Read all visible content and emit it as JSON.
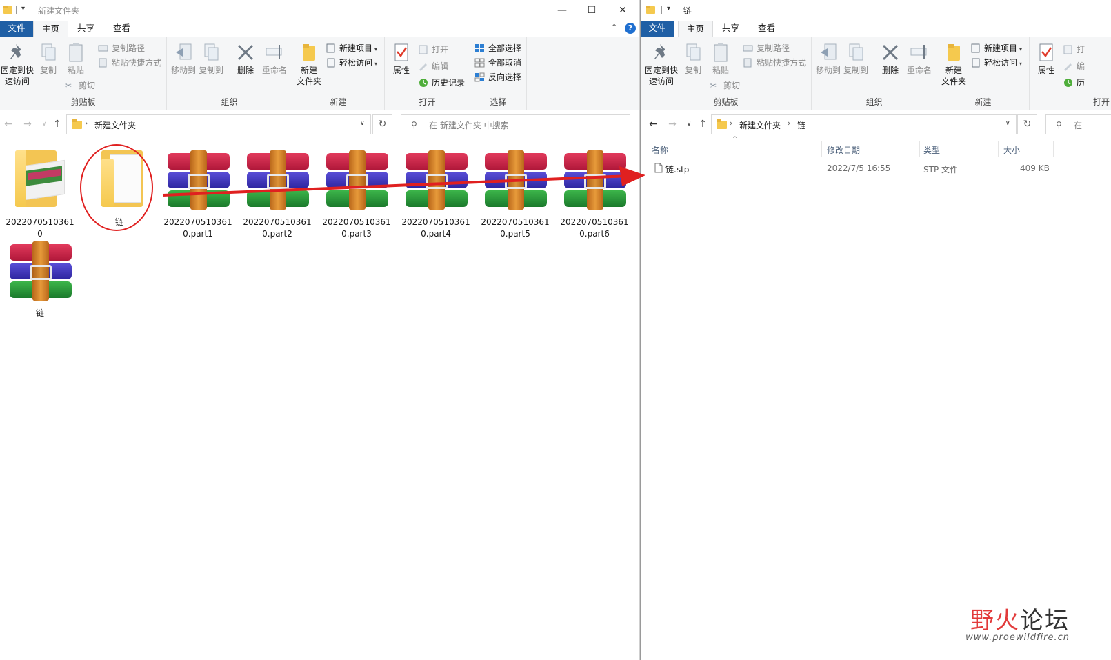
{
  "left": {
    "title": "新建文件夹",
    "tabs": {
      "file": "文件",
      "home": "主页",
      "share": "共享",
      "view": "查看"
    },
    "ribbon": {
      "pin": "固定到快\n速访问",
      "copy": "复制",
      "paste": "粘贴",
      "copy_path": "复制路径",
      "paste_shortcut": "粘贴快捷方式",
      "cut": "剪切",
      "clipboard": "剪贴板",
      "move_to": "移动到",
      "copy_to": "复制到",
      "delete": "删除",
      "rename": "重命名",
      "organize": "组织",
      "new_folder": "新建\n文件夹",
      "new_item": "新建项目",
      "easy_access": "轻松访问",
      "new": "新建",
      "properties": "属性",
      "open": "打开",
      "edit": "编辑",
      "history": "历史记录",
      "open_group": "打开",
      "select_all": "全部选择",
      "select_none": "全部取消",
      "invert": "反向选择",
      "select": "选择"
    },
    "address": {
      "crumb1": "新建文件夹"
    },
    "search_placeholder": "在 新建文件夹 中搜索",
    "items": [
      {
        "label": "2022070510361\n0",
        "kind": "folder-thumb"
      },
      {
        "label": "链",
        "kind": "folder"
      },
      {
        "label": "2022070510361\n0.part1",
        "kind": "rar"
      },
      {
        "label": "2022070510361\n0.part2",
        "kind": "rar"
      },
      {
        "label": "2022070510361\n0.part3",
        "kind": "rar"
      },
      {
        "label": "2022070510361\n0.part4",
        "kind": "rar"
      },
      {
        "label": "2022070510361\n0.part5",
        "kind": "rar"
      },
      {
        "label": "2022070510361\n0.part6",
        "kind": "rar"
      },
      {
        "label": "链",
        "kind": "rar"
      }
    ]
  },
  "right": {
    "title": "链",
    "tabs": {
      "file": "文件",
      "home": "主页",
      "share": "共享",
      "view": "查看"
    },
    "ribbon": {
      "pin": "固定到快\n速访问",
      "copy": "复制",
      "paste": "粘贴",
      "copy_path": "复制路径",
      "paste_shortcut": "粘贴快捷方式",
      "cut": "剪切",
      "clipboard": "剪贴板",
      "move_to": "移动到",
      "copy_to": "复制到",
      "delete": "删除",
      "rename": "重命名",
      "organize": "组织",
      "new_folder": "新建\n文件夹",
      "new_item": "新建项目",
      "easy_access": "轻松访问",
      "new": "新建",
      "properties": "属性",
      "open_partial": "打",
      "edit_partial": "编",
      "history_partial": "历",
      "open_group": "打开"
    },
    "address": {
      "crumb1": "新建文件夹",
      "crumb2": "链"
    },
    "search_partial": "在",
    "columns": {
      "name": "名称",
      "modified": "修改日期",
      "type": "类型",
      "size": "大小"
    },
    "files": [
      {
        "name": "链.stp",
        "modified": "2022/7/5 16:55",
        "type": "STP 文件",
        "size": "409 KB"
      }
    ]
  },
  "watermark": {
    "cn1": "野",
    "cn2": "火",
    "cn3": "论坛",
    "en": "www.proewildfire.cn"
  },
  "colors": {
    "accent": "#1f5fa5",
    "annotation": "#e02020"
  }
}
